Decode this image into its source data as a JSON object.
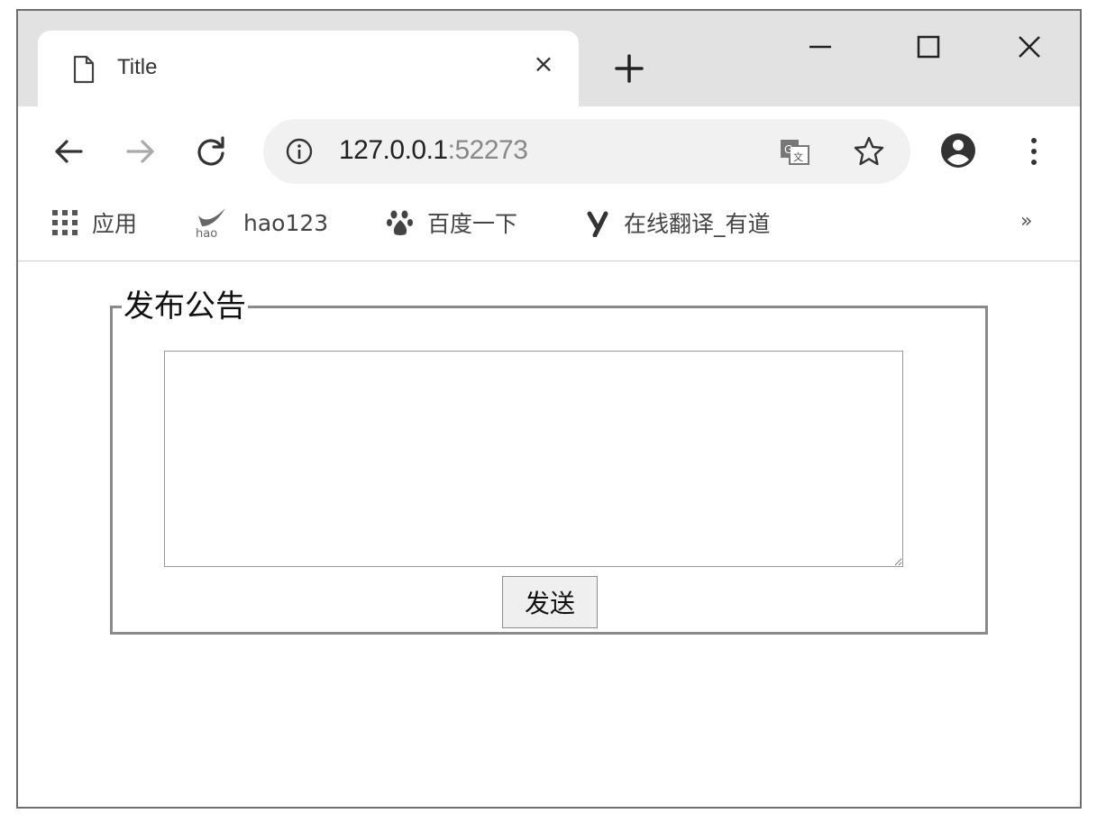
{
  "tab": {
    "title": "Title",
    "close_symbol": "×",
    "new_tab_symbol": "+"
  },
  "address_bar": {
    "host": "127.0.0.1",
    "port": ":52273"
  },
  "bookmarks": {
    "items": [
      {
        "label": "应用",
        "icon": "apps-grid-icon"
      },
      {
        "label": "hao123",
        "icon": "hao123-icon"
      },
      {
        "label": "百度一下",
        "icon": "baidu-paw-icon"
      },
      {
        "label": "在线翻译_有道",
        "icon": "youdao-icon"
      }
    ],
    "more_symbol": "»"
  },
  "form": {
    "legend": "发布公告",
    "textarea_value": "",
    "send_label": "发送"
  },
  "icons": {
    "page": "page-icon",
    "back": "back-arrow-icon",
    "forward": "forward-arrow-icon",
    "reload": "reload-icon",
    "info": "info-icon",
    "translate": "translate-icon",
    "star": "star-icon",
    "profile": "profile-icon",
    "menu": "menu-dots-icon",
    "minimize": "minimize-icon",
    "maximize": "maximize-icon",
    "close": "close-window-icon"
  }
}
